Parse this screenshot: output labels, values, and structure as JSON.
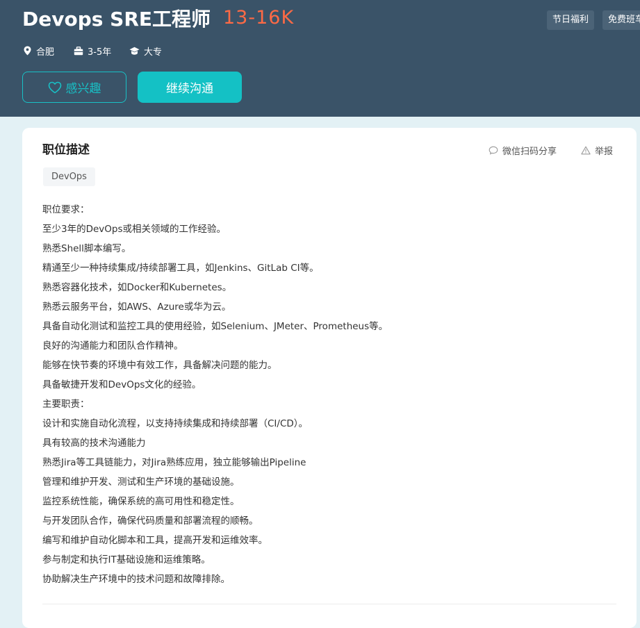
{
  "job": {
    "title": "Devops SRE工程师",
    "salary": "13-16K",
    "tags": [
      "节日福利",
      "免费班车"
    ],
    "location": "合肥",
    "experience": "3-5年",
    "education": "大专"
  },
  "actions": {
    "interested_label": "感兴趣",
    "continue_label": "继续沟通"
  },
  "description": {
    "section_title": "职位描述",
    "share_label": "微信扫码分享",
    "report_label": "举报",
    "skill_tags": [
      "DevOps"
    ],
    "lines": [
      "职位要求：",
      "至少3年的DevOps或相关领域的工作经验。",
      "熟悉Shell脚本编写。",
      "精通至少一种持续集成/持续部署工具，如Jenkins、GitLab CI等。",
      "熟悉容器化技术，如Docker和Kubernetes。",
      "熟悉云服务平台，如AWS、Azure或华为云。",
      "具备自动化测试和监控工具的使用经验，如Selenium、JMeter、Prometheus等。",
      "良好的沟通能力和团队合作精神。",
      "能够在快节奏的环境中有效工作，具备解决问题的能力。",
      "具备敏捷开发和DevOps文化的经验。",
      "主要职责：",
      "设计和实施自动化流程，以支持持续集成和持续部署（CI/CD）。",
      "具有较高的技术沟通能力",
      "熟悉Jira等工具链能力，对Jira熟练应用，独立能够输出Pipeline",
      "管理和维护开发、测试和生产环境的基础设施。",
      "监控系统性能，确保系统的高可用性和稳定性。",
      "与开发团队合作，确保代码质量和部署流程的顺畅。",
      "编写和维护自动化脚本和工具，提高开发和运维效率。",
      "参与制定和执行IT基础设施和运维策略。",
      "协助解决生产环境中的技术问题和故障排除。"
    ]
  },
  "colors": {
    "header_bg": "#3a5368",
    "salary": "#ff6a45",
    "accent": "#14c1c5",
    "page_bg": "#e3f1f5"
  },
  "icons": {
    "location": "location-pin-icon",
    "experience": "briefcase-icon",
    "education": "graduation-cap-icon",
    "interested": "heart-outline-icon",
    "share": "chat-bubble-icon",
    "report": "warning-triangle-icon"
  }
}
